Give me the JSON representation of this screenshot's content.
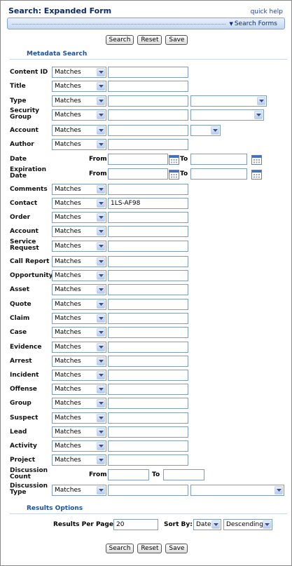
{
  "page": {
    "title": "Search: Expanded Form",
    "quick_help": "quick help",
    "search_forms_link": "Search Forms"
  },
  "buttons": {
    "search": "Search",
    "reset": "Reset",
    "save": "Save"
  },
  "metadata_search": {
    "heading": "Metadata Search",
    "operator_default": "Matches",
    "from_label": "From",
    "to_label": "To",
    "fields": [
      {
        "label": "Content ID"
      },
      {
        "label": "Title"
      },
      {
        "label": "Type"
      },
      {
        "label": "Security Group"
      },
      {
        "label": "Account"
      },
      {
        "label": "Author"
      },
      {
        "label": "Date"
      },
      {
        "label": "Expiration Date"
      },
      {
        "label": "Comments"
      },
      {
        "label": "Contact",
        "value": "1LS-AF98"
      },
      {
        "label": "Order"
      },
      {
        "label": "Account"
      },
      {
        "label": "Service Request"
      },
      {
        "label": "Call Report"
      },
      {
        "label": "Opportunity"
      },
      {
        "label": "Asset"
      },
      {
        "label": "Quote"
      },
      {
        "label": "Claim"
      },
      {
        "label": "Case"
      },
      {
        "label": "Evidence"
      },
      {
        "label": "Arrest"
      },
      {
        "label": "Incident"
      },
      {
        "label": "Offense"
      },
      {
        "label": "Group"
      },
      {
        "label": "Suspect"
      },
      {
        "label": "Lead"
      },
      {
        "label": "Activity"
      },
      {
        "label": "Project"
      },
      {
        "label": "Discussion Count"
      },
      {
        "label": "Discussion Type"
      }
    ]
  },
  "results_options": {
    "heading": "Results Options",
    "per_page_label": "Results Per Page:",
    "per_page_value": "20",
    "sort_by_label": "Sort By:",
    "sort_field": "Date",
    "sort_order": "Descending"
  }
}
